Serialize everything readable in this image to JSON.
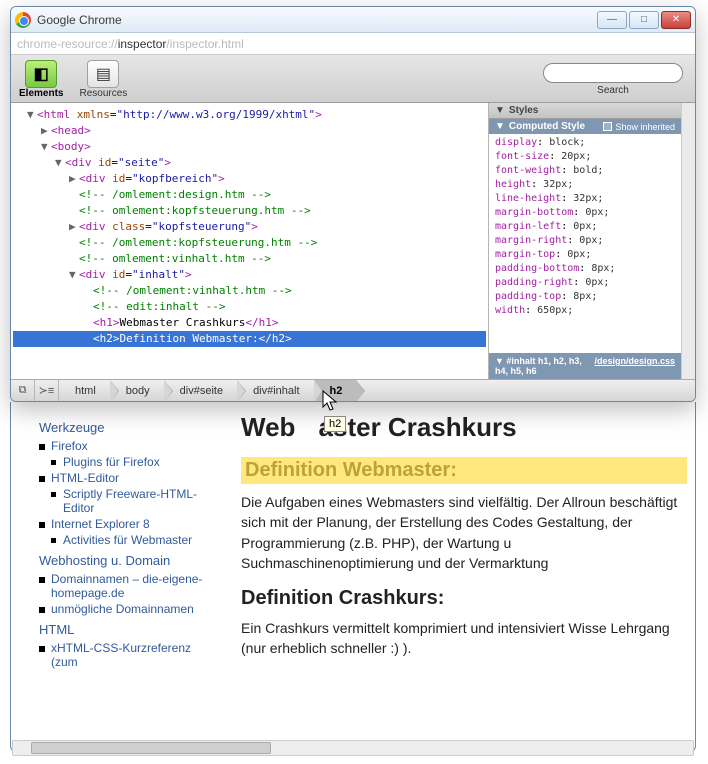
{
  "window": {
    "title": "Google Chrome",
    "address_prefix": "chrome-resource://",
    "address_dark": "inspector",
    "address_suffix": "/inspector.html"
  },
  "toolbar": {
    "elements": "Elements",
    "resources": "Resources",
    "search": "Search"
  },
  "dom": {
    "html_open": "<html xmlns=\"http://www.w3.org/1999/xhtml\">",
    "head": "<head>",
    "body": "<body>",
    "div_seite": "<div id=\"seite\">",
    "div_kopf": "<div id=\"kopfbereich\">",
    "c1": "<!-- /omlement:design.htm -->",
    "c2": "<!-- omlement:kopfsteuerung.htm -->",
    "div_kopfst": "<div class=\"kopfsteuerung\">",
    "c3": "<!-- /omlement:kopfsteuerung.htm -->",
    "c4": "<!-- omlement:vinhalt.htm -->",
    "div_inhalt": "<div id=\"inhalt\">",
    "c5": "<!-- /omlement:vinhalt.htm -->",
    "c6": "<!-- edit:inhalt -->",
    "h1": "<h1>Webmaster Crashkurs</h1>",
    "h2": "<h2>Definition Webmaster:</h2>"
  },
  "crumbs": {
    "html": "html",
    "body": "body",
    "seite": "div#seite",
    "inhalt": "div#inhalt",
    "h2": "h2"
  },
  "styles": {
    "title": "Styles",
    "computed": "Computed Style",
    "inherited": "Show inherited",
    "props": [
      {
        "k": "display",
        "v": "block"
      },
      {
        "k": "font-size",
        "v": "20px"
      },
      {
        "k": "font-weight",
        "v": "bold"
      },
      {
        "k": "height",
        "v": "32px"
      },
      {
        "k": "line-height",
        "v": "32px"
      },
      {
        "k": "margin-bottom",
        "v": "0px"
      },
      {
        "k": "margin-left",
        "v": "0px"
      },
      {
        "k": "margin-right",
        "v": "0px"
      },
      {
        "k": "margin-top",
        "v": "0px"
      },
      {
        "k": "padding-bottom",
        "v": "8px"
      },
      {
        "k": "padding-right",
        "v": "0px"
      },
      {
        "k": "padding-top",
        "v": "8px"
      },
      {
        "k": "width",
        "v": "650px"
      }
    ],
    "rule_sel": "#inhalt h1, h2, h3, h4, h5, h6",
    "rule_src": "/design/design.css"
  },
  "page": {
    "side": {
      "werkzeuge": "Werkzeuge",
      "firefox": "Firefox",
      "firefox_sub": "Plugins für Firefox",
      "htmled": "HTML-Editor",
      "htmled_sub": "Scriptly Freeware-HTML-Editor",
      "ie8": "Internet Explorer 8",
      "ie8_sub": "Activities für Webmaster",
      "webhost": "Webhosting u. Domain",
      "dom1": "Domainnamen – die-eigene-homepage.de",
      "dom2": "unmögliche Domainnamen",
      "html": "HTML",
      "xref": "xHTML-CSS-Kurzreferenz (zum"
    },
    "main": {
      "h1_a": "Web",
      "h1_b": "aster Crashkurs",
      "h2a": "Definition Webmaster:",
      "p1": "Die Aufgaben eines Webmasters sind vielfältig. Der Allroun beschäftigt sich mit der Planung, der Erstellung des Codes Gestaltung, der Programmierung (z.B. PHP), der Wartung u Suchmaschinenoptimierung und der Vermarktung",
      "h2b": "Definition Crashkurs:",
      "p2": "Ein Crashkurs vermittelt komprimiert und intensiviert Wisse Lehrgang (nur erheblich schneller :) )."
    }
  },
  "tooltip": "h2"
}
